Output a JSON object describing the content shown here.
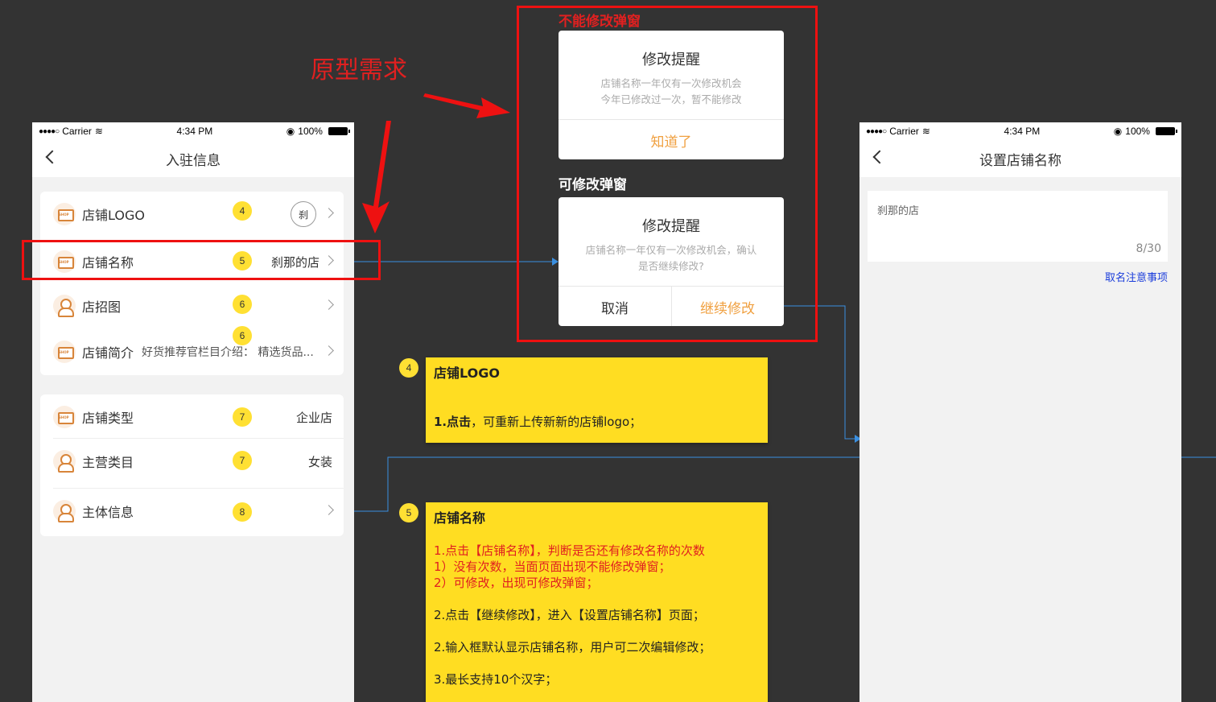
{
  "annotations": {
    "prototype_label": "原型需求",
    "no_edit_label": "不能修改弹窗",
    "can_edit_label": "可修改弹窗"
  },
  "status_bar": {
    "carrier": "Carrier",
    "time": "4:34 PM",
    "battery": "100%"
  },
  "left_screen": {
    "title": "入驻信息",
    "rows": [
      {
        "label": "店铺LOGO",
        "badge": "4",
        "value": "刹"
      },
      {
        "label": "店铺名称",
        "badge": "5",
        "value": "刹那的店"
      },
      {
        "label": "店招图",
        "badge": "6",
        "value": ""
      },
      {
        "label": "店铺简介",
        "badge": "6",
        "value": "好货推荐官栏目介绍：  精选货品..."
      },
      {
        "label": "店铺类型",
        "badge": "7",
        "value": "企业店"
      },
      {
        "label": "主营类目",
        "badge": "7",
        "value": "女装"
      },
      {
        "label": "主体信息",
        "badge": "8",
        "value": ""
      }
    ]
  },
  "dialog_no_edit": {
    "title": "修改提醒",
    "msg_line1": "店铺名称一年仅有一次修改机会",
    "msg_line2": "今年已修改过一次，暂不能修改",
    "button": "知道了"
  },
  "dialog_can_edit": {
    "title": "修改提醒",
    "msg_line1": "店铺名称一年仅有一次修改机会，确认",
    "msg_line2": "是否继续修改?",
    "cancel": "取消",
    "confirm": "继续修改"
  },
  "right_screen": {
    "title": "设置店铺名称",
    "input_value": "刹那的店",
    "counter": "8/30",
    "link": "取名注意事项"
  },
  "note4": {
    "badge": "4",
    "title": "店铺LOGO",
    "line1_bold": "1.点击",
    "line1_rest": "，可重新上传新新的店铺logo；"
  },
  "note5": {
    "badge": "5",
    "title": "店铺名称",
    "lines_red": [
      "1.点击【店铺名称】，判断是否还有修改名称的次数",
      "1）没有次数，当面页面出现不能修改弹窗；",
      "2）可修改，出现可修改弹窗；"
    ],
    "lines": [
      "2.点击【继续修改】，进入【设置店铺名称】页面；",
      "2.输入框默认显示店铺名称，用户可二次编辑修改；",
      "3.最长支持10个汉字；"
    ]
  },
  "colors": {
    "background": "#333333",
    "annotation_red": "#ee1111",
    "note_yellow": "#ffdd22",
    "accent_orange": "#f0a040",
    "link_blue": "#1a3cdb",
    "connector_blue": "#3a8fe0"
  }
}
